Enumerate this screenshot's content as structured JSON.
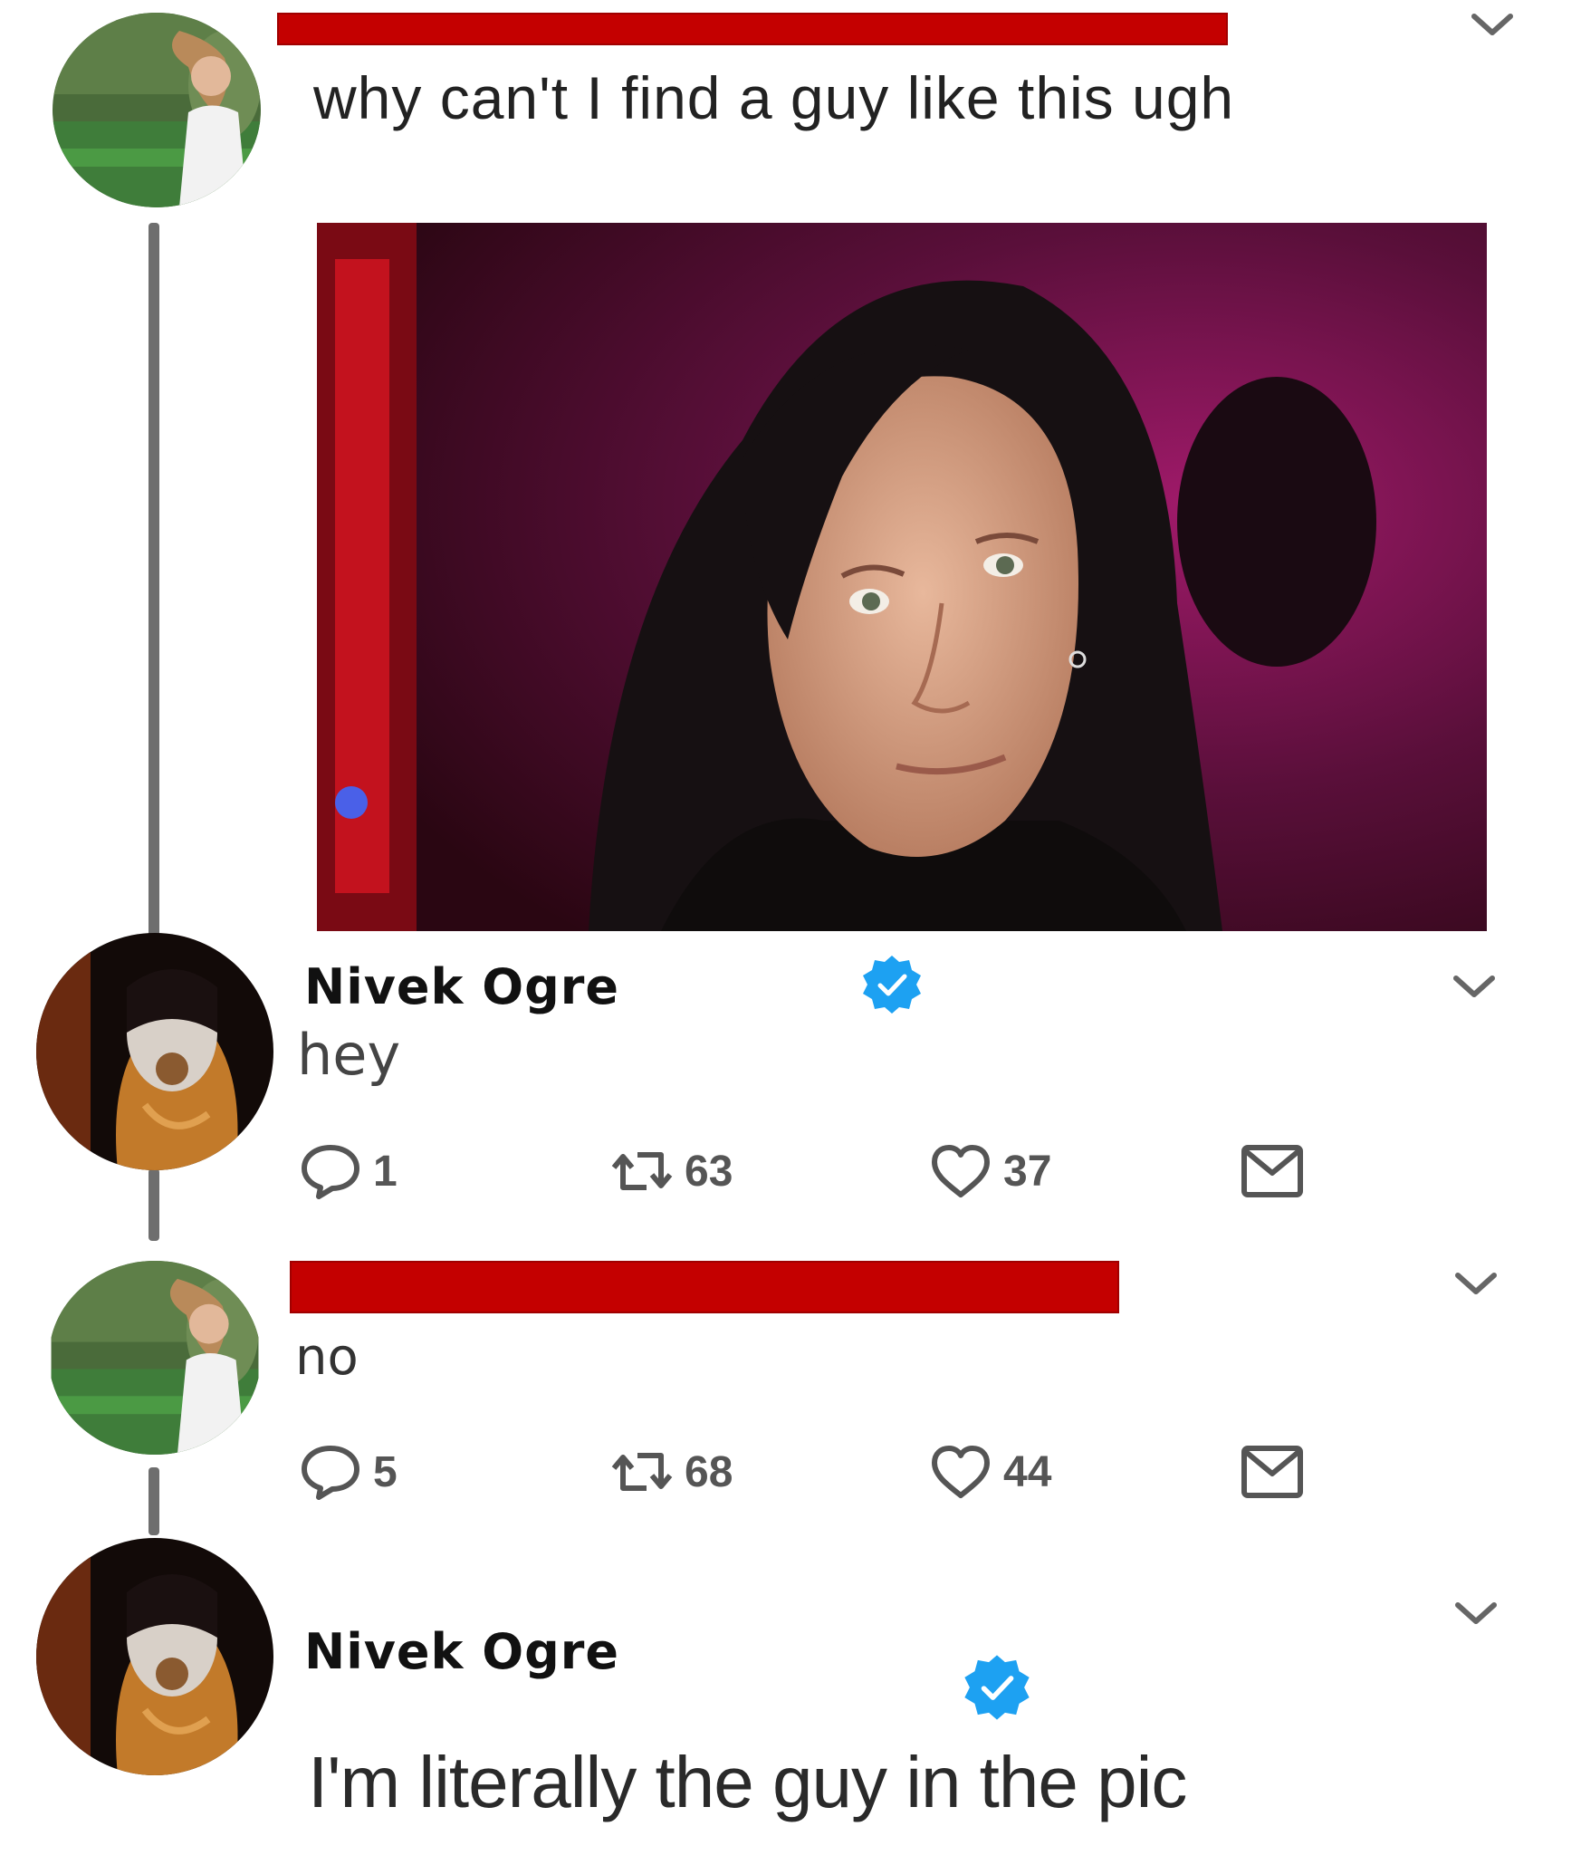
{
  "tweets": [
    {
      "author_redacted": true,
      "text": "why can't I find a guy like this ugh",
      "has_photo": true
    },
    {
      "display_name": "Nivek Ogre",
      "verified": true,
      "text": "hey",
      "actions": {
        "replies": "1",
        "retweets": "63",
        "likes": "37"
      }
    },
    {
      "author_redacted": true,
      "text": "no",
      "actions": {
        "replies": "5",
        "retweets": "68",
        "likes": "44"
      }
    },
    {
      "display_name": "Nivek Ogre",
      "verified": true,
      "text": "I'm literally the guy in the pic"
    }
  ],
  "colors": {
    "redaction": "#c40000",
    "verified_blue": "#1da1f2",
    "action_gray": "#555555",
    "thread_line": "#6e6e6e"
  },
  "icons": [
    "chevron-down-icon",
    "reply-icon",
    "retweet-icon",
    "like-icon",
    "message-icon",
    "verified-badge-icon"
  ]
}
